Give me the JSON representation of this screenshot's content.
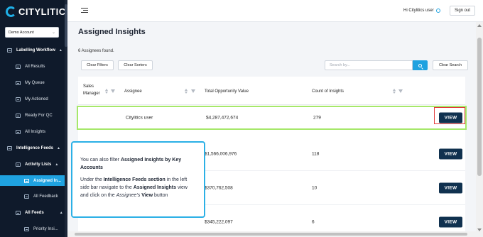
{
  "brand": {
    "name": "CITYLITICS",
    "accent": "#1fa2e0"
  },
  "sidebar": {
    "account": "Demo Account",
    "sections": [
      {
        "label": "Labelling Workflow",
        "items": [
          "All Results",
          "My Queue",
          "My Actioned",
          "Ready For QC",
          "All Insights"
        ]
      },
      {
        "label": "Intelligence Feeds",
        "items": [
          "Activity Lists",
          "Assigned In...",
          "All Feedback",
          "All Feeds",
          "Priority Insi..."
        ]
      }
    ]
  },
  "topbar": {
    "greeting": "Hi Citylitics user",
    "signout": "Sign out"
  },
  "page": {
    "title": "Assigned Insights",
    "found": "6 Assignees found.",
    "clear_filters": "Clear Filters",
    "clear_sorters": "Clear Sorters",
    "search_placeholder": "Search by...",
    "clear_search": "Clear Search"
  },
  "table": {
    "columns": [
      "Sales Manager",
      "Assignee",
      "Total Opportunity Value",
      "Count of Insights"
    ],
    "rows": [
      {
        "sales_manager": "",
        "assignee": "Citylitics user",
        "total": "$4,287,472,674",
        "count": "279",
        "action": "VIEW"
      },
      {
        "sales_manager": "",
        "assignee": "",
        "total": "$1,566,006,976",
        "count": "118",
        "action": "VIEW"
      },
      {
        "sales_manager": "",
        "assignee": "",
        "total": "$370,762,508",
        "count": "10",
        "action": "VIEW"
      },
      {
        "sales_manager": "",
        "assignee": "",
        "total": "$345,222,097",
        "count": "6",
        "action": "VIEW"
      }
    ]
  },
  "callout": {
    "p1_pre": "You can also filter ",
    "p1_bold": "Assigned Insights by Key Accounts",
    "p2_a": "Under the ",
    "p2_b": "Intelligence Feeds section",
    "p2_c": " in the left side bar navigate to the ",
    "p2_d": "Assigned Insights",
    "p2_e": " view and click on the ",
    "p2_f": "Assignee's",
    "p2_g": " ",
    "p2_h": "View",
    "p2_i": " button"
  }
}
